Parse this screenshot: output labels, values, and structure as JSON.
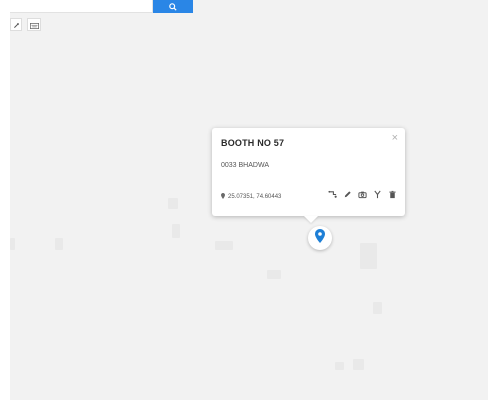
{
  "search": {
    "placeholder": "",
    "button_icon": "search-icon"
  },
  "tools": [
    {
      "icon": "edit-icon"
    },
    {
      "icon": "keyboard-icon"
    }
  ],
  "popup": {
    "title": "BOOTH NO 57",
    "subtitle": "0033 BHADWA",
    "coords": "25.07351, 74.60443",
    "close_label": "×",
    "actions": [
      {
        "icon": "route-icon"
      },
      {
        "icon": "pencil-icon"
      },
      {
        "icon": "camera-icon"
      },
      {
        "icon": "fork-icon"
      },
      {
        "icon": "trash-icon"
      }
    ]
  },
  "marker": {
    "icon": "map-pin-icon",
    "color": "#1e7fd6"
  },
  "colors": {
    "accent": "#2a86e6",
    "map_background": "#f2f2f2",
    "marker": "#1e7fd6"
  }
}
